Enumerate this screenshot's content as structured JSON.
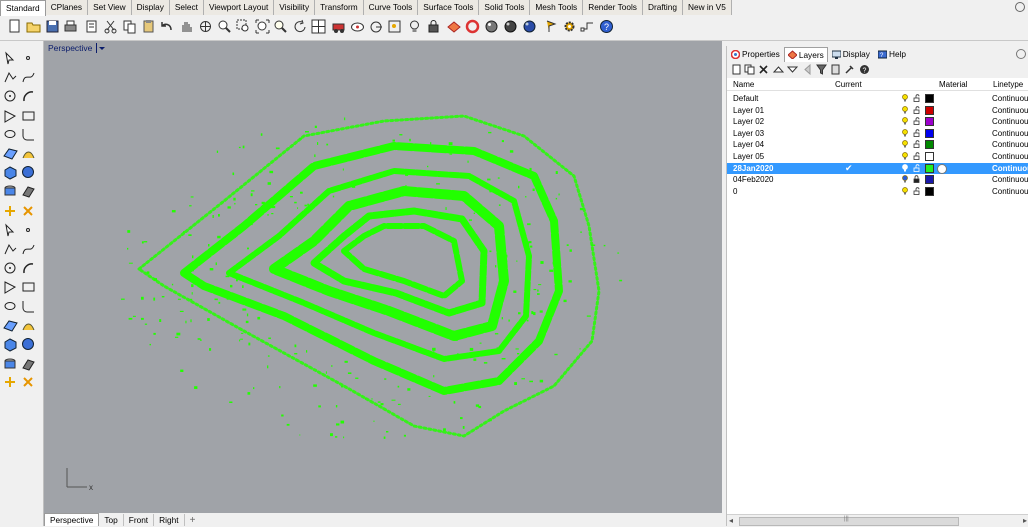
{
  "top_tabs": [
    "Standard",
    "CPlanes",
    "Set View",
    "Display",
    "Select",
    "Viewport Layout",
    "Visibility",
    "Transform",
    "Curve Tools",
    "Surface Tools",
    "Solid Tools",
    "Mesh Tools",
    "Render Tools",
    "Drafting",
    "New in V5"
  ],
  "active_top_tab": "Standard",
  "viewport": {
    "title": "Perspective",
    "axis_x": "x",
    "point_cloud_color": "#22ff00"
  },
  "viewport_tabs": [
    "Perspective",
    "Top",
    "Front",
    "Right"
  ],
  "viewport_add_symbol": "+",
  "panel_tabs": [
    "Properties",
    "Layers",
    "Display",
    "Help"
  ],
  "active_panel_tab": "Layers",
  "layer_columns": {
    "name": "Name",
    "current": "Current",
    "material": "Material",
    "linetype": "Linetype"
  },
  "layers": [
    {
      "name": "Default",
      "color": "#000000",
      "linetype": "Continuous",
      "current": false,
      "selected": false
    },
    {
      "name": "Layer 01",
      "color": "#cc0000",
      "linetype": "Continuous",
      "current": false,
      "selected": false
    },
    {
      "name": "Layer 02",
      "color": "#9b00cc",
      "linetype": "Continuous",
      "current": false,
      "selected": false
    },
    {
      "name": "Layer 03",
      "color": "#0000ee",
      "linetype": "Continuous",
      "current": false,
      "selected": false
    },
    {
      "name": "Layer 04",
      "color": "#008800",
      "linetype": "Continuous",
      "current": false,
      "selected": false
    },
    {
      "name": "Layer 05",
      "color": "#ffffff",
      "linetype": "Continuous",
      "current": false,
      "selected": false
    },
    {
      "name": "28Jan2020",
      "color": "#22ee22",
      "linetype": "Continuous",
      "current": true,
      "selected": true
    },
    {
      "name": "04Feb2020",
      "color": "#1a1aaa",
      "linetype": "Continuous",
      "current": false,
      "selected": false
    },
    {
      "name": "0",
      "color": "#000000",
      "linetype": "Continuous",
      "current": false,
      "selected": false
    }
  ],
  "current_check": "✔",
  "scroll_grip": "|||"
}
